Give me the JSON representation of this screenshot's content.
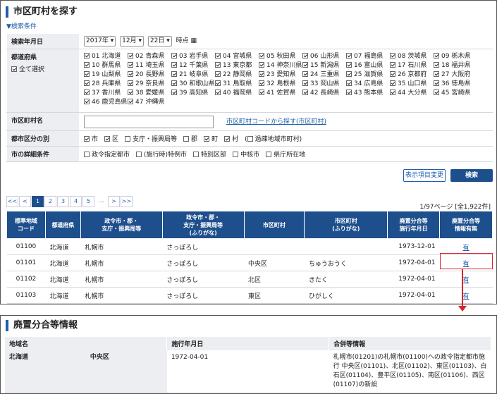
{
  "page_title": "市区町村を探す",
  "conditions_toggle": "▼検索条件",
  "filter": {
    "date_label": "検索年月日",
    "year": "2017年",
    "month": "12月",
    "day": "22日",
    "date_suffix": "時点",
    "pref_label": "都道府県",
    "select_all": "全て選択",
    "prefectures": [
      "01 北海道",
      "02 青森県",
      "03 岩手県",
      "04 宮城県",
      "05 秋田県",
      "06 山形県",
      "07 福島県",
      "08 茨城県",
      "09 栃木県",
      "10 群馬県",
      "11 埼玉県",
      "12 千葉県",
      "13 東京都",
      "14 神奈川県",
      "15 新潟県",
      "16 富山県",
      "17 石川県",
      "18 福井県",
      "19 山梨県",
      "20 長野県",
      "21 岐阜県",
      "22 静岡県",
      "23 愛知県",
      "24 三重県",
      "25 滋賀県",
      "26 京都府",
      "27 大阪府",
      "28 兵庫県",
      "29 奈良県",
      "30 和歌山県",
      "31 鳥取県",
      "32 島根県",
      "33 岡山県",
      "34 広島県",
      "35 山口県",
      "36 徳島県",
      "37 香川県",
      "38 愛媛県",
      "39 高知県",
      "40 福岡県",
      "41 佐賀県",
      "42 長崎県",
      "43 熊本県",
      "44 大分県",
      "45 宮崎県",
      "46 鹿児島県",
      "47 沖縄県"
    ],
    "city_label": "市区町村名",
    "city_value": "",
    "code_link": "市区町村コードから探す(市区町村)",
    "class_label": "都市区分の別",
    "classes": [
      {
        "label": "市",
        "checked": true
      },
      {
        "label": "区",
        "checked": true
      },
      {
        "label": "支庁・振興局等",
        "checked": false
      },
      {
        "label": "郡",
        "checked": false
      },
      {
        "label": "町",
        "checked": true
      },
      {
        "label": "村",
        "checked": true
      },
      {
        "label": "過疎地域市町村",
        "checked": false,
        "paren": true
      }
    ],
    "detail_label": "市の詳細条件",
    "details": [
      "政令指定都市",
      "(施行時)特例市",
      "特別区部",
      "中核市",
      "県庁所在地"
    ]
  },
  "buttons": {
    "columns": "表示項目変更",
    "search": "検索"
  },
  "pager": {
    "first": "<<",
    "prev": "<",
    "pages": [
      "1",
      "2",
      "3",
      "4",
      "5"
    ],
    "ellipsis": "…",
    "next": ">",
    "last": ">>",
    "info": "1/97ページ [全1,922件]"
  },
  "results": {
    "headers": [
      "標準地域\nコード",
      "都道府県",
      "政令市・郡・\n支庁・振興局等",
      "政令市・郡・\n支庁・振興局等\n(ふりがな)",
      "市区町村",
      "市区町村\n(ふりがな)",
      "廃置分合等\n施行年月日",
      "廃置分合等\n情報有無"
    ],
    "rows": [
      [
        "01100",
        "北海道",
        "札幌市",
        "さっぽろし",
        "",
        "",
        "1973-12-01",
        "有"
      ],
      [
        "01101",
        "北海道",
        "札幌市",
        "さっぽろし",
        "中央区",
        "ちゅうおうく",
        "1972-04-01",
        "有"
      ],
      [
        "01102",
        "北海道",
        "札幌市",
        "さっぽろし",
        "北区",
        "きたく",
        "1972-04-01",
        "有"
      ],
      [
        "01103",
        "北海道",
        "札幌市",
        "さっぽろし",
        "東区",
        "ひがしく",
        "1972-04-01",
        "有"
      ]
    ]
  },
  "detail": {
    "title": "廃置分合等情報",
    "headers": [
      "地域名",
      "施行年月日",
      "合併等情報"
    ],
    "pref": "北海道",
    "ward": "中央区",
    "date": "1972-04-01",
    "info": "札幌市(01201)の札幌市(01100)への政令指定都市施行 中央区(01101)、北区(01102)、東区(01103)、白石区(01104)、豊平区(01105)、南区(01106)、西区(01107)の新設"
  },
  "colors": {
    "accent": "#1e4f8d",
    "link": "#1f5fa8",
    "highlight": "#d9262c"
  }
}
